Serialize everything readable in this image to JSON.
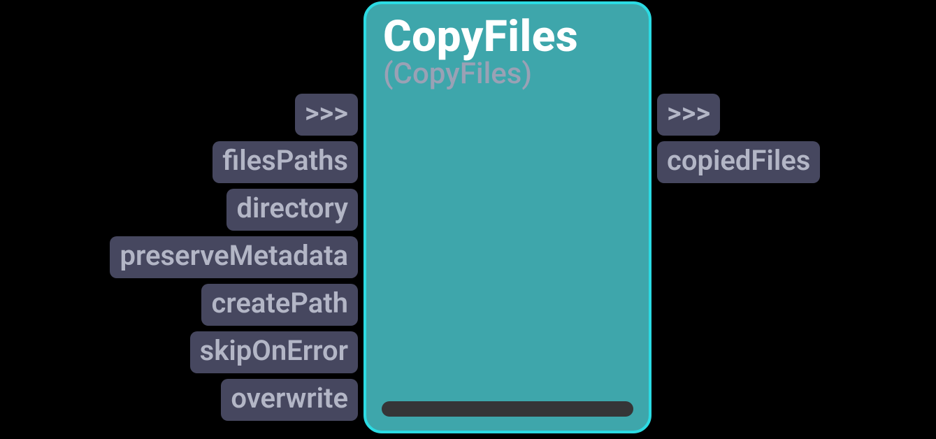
{
  "node": {
    "title": "CopyFiles",
    "subtitle": "(CopyFiles)"
  },
  "inputs": [
    {
      "label": ">>>"
    },
    {
      "label": "filesPaths"
    },
    {
      "label": "directory"
    },
    {
      "label": "preserveMetadata"
    },
    {
      "label": "createPath"
    },
    {
      "label": "skipOnError"
    },
    {
      "label": "overwrite"
    }
  ],
  "outputs": [
    {
      "label": ">>>"
    },
    {
      "label": "copiedFiles"
    }
  ]
}
